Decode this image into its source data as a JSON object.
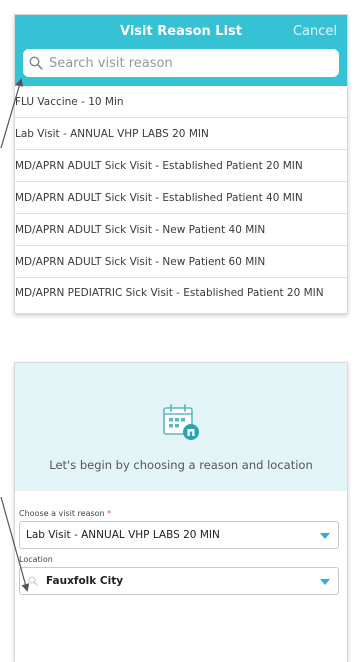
{
  "reason_list": {
    "title": "Visit Reason List",
    "cancel_label": "Cancel",
    "search_placeholder": "Search visit reason",
    "items": [
      "FLU Vaccine - 10 Min",
      "Lab Visit - ANNUAL VHP LABS 20 MIN",
      "MD/APRN ADULT Sick Visit - Established Patient 20 MIN",
      "MD/APRN ADULT Sick Visit - Established Patient 40 MIN",
      "MD/APRN ADULT Sick Visit - New Patient 40 MIN",
      "MD/APRN ADULT Sick Visit - New Patient 60 MIN",
      "MD/APRN PEDIATRIC Sick Visit - Established Patient 20 MIN"
    ]
  },
  "form": {
    "intro": "Let's begin by choosing a reason and location",
    "reason_label": "Choose a visit reason",
    "required_mark": "*",
    "reason_value": "Lab Visit - ANNUAL VHP LABS 20 MIN",
    "location_label": "Location",
    "location_value": "Fauxfolk City"
  },
  "icons": {
    "search": "search-icon",
    "calendar": "calendar-clinic-icon",
    "dropdown": "chevron-down-icon"
  },
  "colors": {
    "header": "#34c2d4",
    "hero_bg": "#e3f4f6",
    "caret": "#3aa7e0",
    "required": "#e8474b"
  }
}
